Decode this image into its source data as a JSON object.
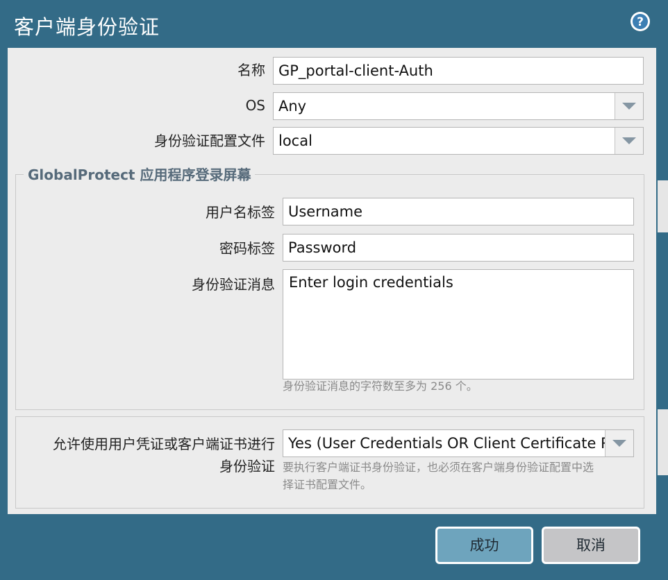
{
  "dialog": {
    "title": "客户端身份验证",
    "help_icon": "help-circle-icon"
  },
  "form": {
    "name_label": "名称",
    "name_value": "GP_portal-client-Auth",
    "os_label": "OS",
    "os_value": "Any",
    "auth_profile_label": "身份验证配置文件",
    "auth_profile_value": "local"
  },
  "login_screen": {
    "legend": "GlobalProtect 应用程序登录屏幕",
    "username_label": "用户名标签",
    "username_value": "Username",
    "password_label": "密码标签",
    "password_value": "Password",
    "auth_message_label": "身份验证消息",
    "auth_message_value": "Enter login credentials",
    "auth_message_hint": "身份验证消息的字符数至多为 256 个。"
  },
  "cert_section": {
    "label_line1": "允许使用用户凭证或客户端证书进行",
    "label_line2": "身份验证",
    "value": "Yes (User Credentials OR Client Certificate Req",
    "hint_line1": "要执行客户端证书身份验证，也必须在客户端身份验证配置中选",
    "hint_line2": "择证书配置文件。"
  },
  "buttons": {
    "ok": "成功",
    "cancel": "取消"
  },
  "colors": {
    "header": "#336b87",
    "panel": "#ececec",
    "ok_button": "#6ea4bd",
    "cancel_button": "#c5c5c7",
    "legend_text": "#566a7a"
  }
}
